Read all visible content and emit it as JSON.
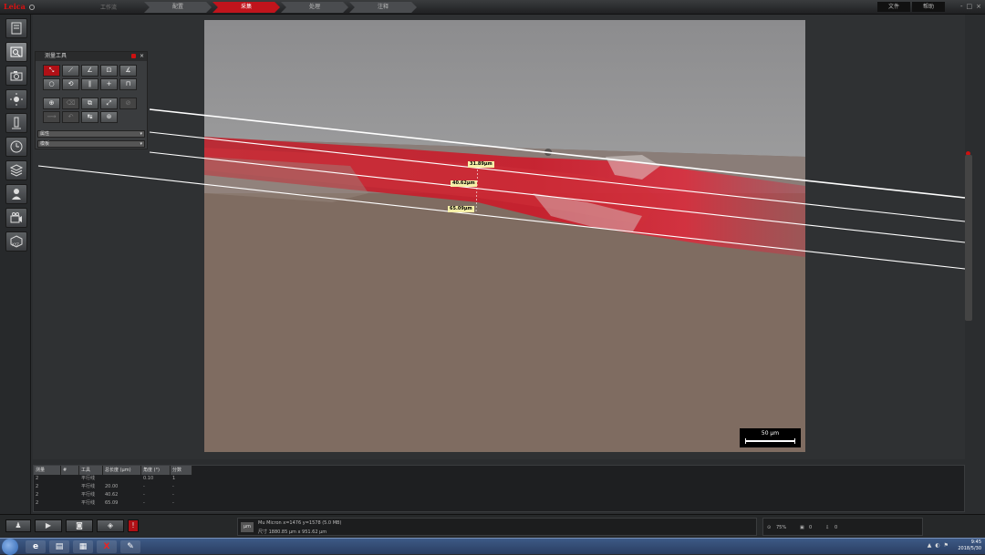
{
  "app": {
    "logo_text": "Leica",
    "workspace_select": "工作流",
    "steps": [
      {
        "label": "配置",
        "active": false
      },
      {
        "label": "采集",
        "active": true
      },
      {
        "label": "处理",
        "active": false
      },
      {
        "label": "注释",
        "active": false
      }
    ],
    "top_buttons": [
      "文件",
      "帮助"
    ],
    "window_controls": [
      "-",
      "□",
      "×"
    ]
  },
  "leftbar": {
    "icons": [
      "browse-icon",
      "measure-icon",
      "camera-icon",
      "illumination-icon",
      "microscope-icon",
      "timer-icon",
      "layers-icon",
      "user-icon",
      "video-camera-icon",
      "xyz-icon"
    ]
  },
  "tool_panel": {
    "title": "测量工具",
    "row1": [
      "⤡",
      "⟋",
      "∠",
      "⊡",
      "∡"
    ],
    "row2": [
      "○",
      "⟲",
      "∥",
      "+",
      "⊓"
    ],
    "row3": [
      "⊕",
      "⌫",
      "⧉",
      "⤢",
      "⊘"
    ],
    "row4": [
      "⟿",
      "↶",
      "↹",
      "⊛"
    ],
    "dropdown1": "属性",
    "dropdown2": "模板"
  },
  "measurements": {
    "labels": [
      "31.89µm",
      "40.62µm",
      "65.09µm"
    ]
  },
  "scalebar": {
    "label": "50 µm"
  },
  "table": {
    "headers": [
      "测量",
      "#",
      "工具",
      "总长度 (µm)",
      "角度 (°)",
      "分数"
    ],
    "rows": [
      [
        "2",
        "",
        "平行线",
        "",
        "0.10",
        "1"
      ],
      [
        "2",
        "",
        "平行线",
        "20.00",
        "-",
        "-"
      ],
      [
        "2",
        "",
        "平行线",
        "40.62",
        "-",
        "-"
      ],
      [
        "2",
        "",
        "平行线",
        "65.09",
        "-",
        "-"
      ]
    ]
  },
  "status": {
    "unit": "µm",
    "line1": "Mu Micron x=1476 y=1578 (5.0 MB)",
    "line2": "尺寸 1880.85 µm x 951.62 µm",
    "zoom": "75%",
    "count": "0",
    "misc": "0"
  },
  "taskbar": {
    "apps": [
      "ie-icon",
      "folder-icon",
      "explorer-icon",
      "leica-x-icon",
      "paint-icon"
    ],
    "time": "9:45",
    "date": "2018/5/30"
  },
  "colors": {
    "accent": "#c0141c",
    "panel": "#3a3c3e"
  }
}
